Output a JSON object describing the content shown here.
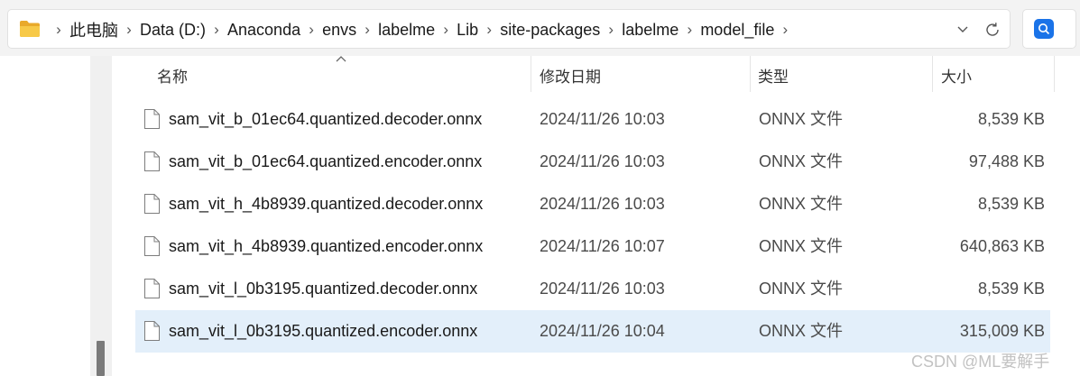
{
  "address_bar": {
    "breadcrumbs": [
      "此电脑",
      "Data (D:)",
      "Anaconda",
      "envs",
      "labelme",
      "Lib",
      "site-packages",
      "labelme",
      "model_file"
    ]
  },
  "columns": {
    "name": "名称",
    "date_modified": "修改日期",
    "type": "类型",
    "size": "大小"
  },
  "files": [
    {
      "name": "sam_vit_b_01ec64.quantized.decoder.onnx",
      "date": "2024/11/26 10:03",
      "type": "ONNX 文件",
      "size": "8,539 KB",
      "selected": false
    },
    {
      "name": "sam_vit_b_01ec64.quantized.encoder.onnx",
      "date": "2024/11/26 10:03",
      "type": "ONNX 文件",
      "size": "97,488 KB",
      "selected": false
    },
    {
      "name": "sam_vit_h_4b8939.quantized.decoder.onnx",
      "date": "2024/11/26 10:03",
      "type": "ONNX 文件",
      "size": "8,539 KB",
      "selected": false
    },
    {
      "name": "sam_vit_h_4b8939.quantized.encoder.onnx",
      "date": "2024/11/26 10:07",
      "type": "ONNX 文件",
      "size": "640,863 KB",
      "selected": false
    },
    {
      "name": "sam_vit_l_0b3195.quantized.decoder.onnx",
      "date": "2024/11/26 10:03",
      "type": "ONNX 文件",
      "size": "8,539 KB",
      "selected": false
    },
    {
      "name": "sam_vit_l_0b3195.quantized.encoder.onnx",
      "date": "2024/11/26 10:04",
      "type": "ONNX 文件",
      "size": "315,009 KB",
      "selected": true
    }
  ],
  "watermark": "CSDN @ML要解手",
  "colors": {
    "selection": "#e3effa",
    "search_accent": "#1a73e8",
    "folder": "#f2c14e"
  },
  "icons": {
    "address_folder": "folder-icon",
    "dropdown": "chevron-down-icon",
    "refresh": "refresh-icon",
    "search": "search-icon",
    "file": "file-icon",
    "sort": "sort-ascending-icon"
  }
}
